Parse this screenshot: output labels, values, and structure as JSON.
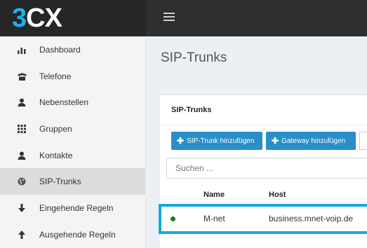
{
  "logo": {
    "part1": "3",
    "part2": "CX"
  },
  "sidebar": {
    "items": [
      {
        "label": "Dashboard",
        "icon": "bar-chart-icon"
      },
      {
        "label": "Telefone",
        "icon": "phone-icon"
      },
      {
        "label": "Nebenstellen",
        "icon": "user-icon"
      },
      {
        "label": "Gruppen",
        "icon": "grid-icon"
      },
      {
        "label": "Kontakte",
        "icon": "user-icon"
      },
      {
        "label": "SIP-Trunks",
        "icon": "globe-icon",
        "active": true
      },
      {
        "label": "Eingehende Regeln",
        "icon": "arrow-down-icon"
      },
      {
        "label": "Ausgehende Regeln",
        "icon": "arrow-up-icon"
      }
    ]
  },
  "main": {
    "title": "SIP-Trunks",
    "panel_title": "SIP-Trunks",
    "buttons": {
      "add_trunk": "SIP-Trunk hinzufügen",
      "add_gateway": "Gateway hinzufügen"
    },
    "search_placeholder": "Suchen ...",
    "table": {
      "columns": [
        "Name",
        "Host"
      ],
      "rows": [
        {
          "status": "online",
          "name": "M-net",
          "host": "business.mnet-voip.de"
        }
      ]
    }
  },
  "colors": {
    "accent": "#2a8ec9",
    "highlight": "#14a8e0",
    "status_online": "#1c7a1c",
    "logo_blue": "#1fb0e8"
  }
}
